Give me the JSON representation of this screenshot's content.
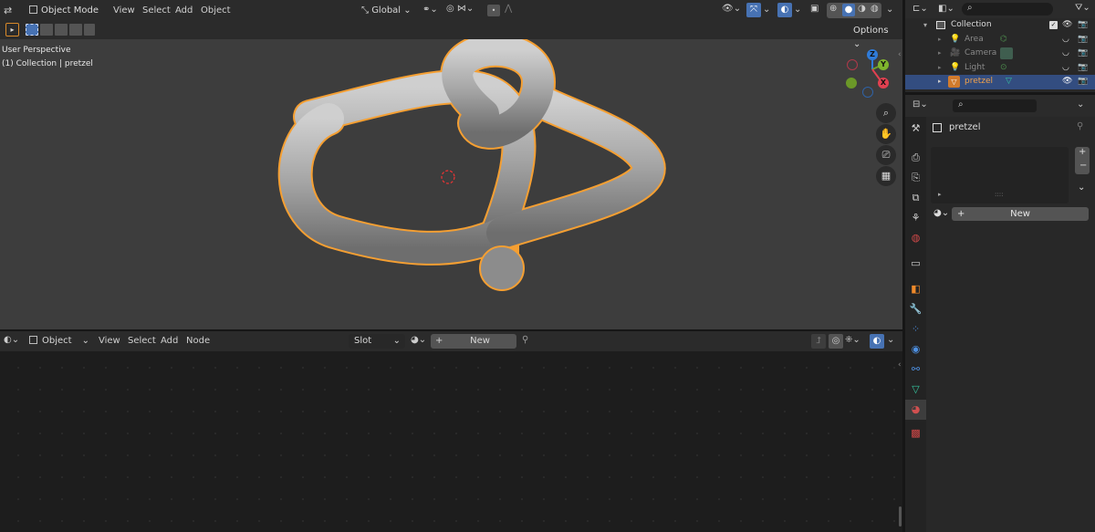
{
  "viewport": {
    "mode": "Object Mode",
    "menus": [
      "View",
      "Select",
      "Add",
      "Object"
    ],
    "transform_orientation": "Global",
    "options_label": "Options",
    "overlay_line1": "User Perspective",
    "overlay_line2": "(1) Collection | pretzel",
    "gizmo": {
      "z": "Z",
      "y": "Y",
      "x": "X"
    }
  },
  "node_editor": {
    "object_label": "Object",
    "menus": [
      "View",
      "Select",
      "Add",
      "Node"
    ],
    "slot_label": "Slot",
    "new_label": "New"
  },
  "outliner": {
    "collection": "Collection",
    "items": [
      {
        "name": "Area",
        "selected": false
      },
      {
        "name": "Camera",
        "selected": false
      },
      {
        "name": "Light",
        "selected": false
      },
      {
        "name": "pretzel",
        "selected": true
      }
    ]
  },
  "properties": {
    "object_name": "pretzel",
    "material_new_label": "New",
    "list_grip": "::::"
  },
  "colors": {
    "accent_blue": "#4772b3",
    "selection_orange": "#f59f32",
    "row_selected": "#334d80"
  }
}
